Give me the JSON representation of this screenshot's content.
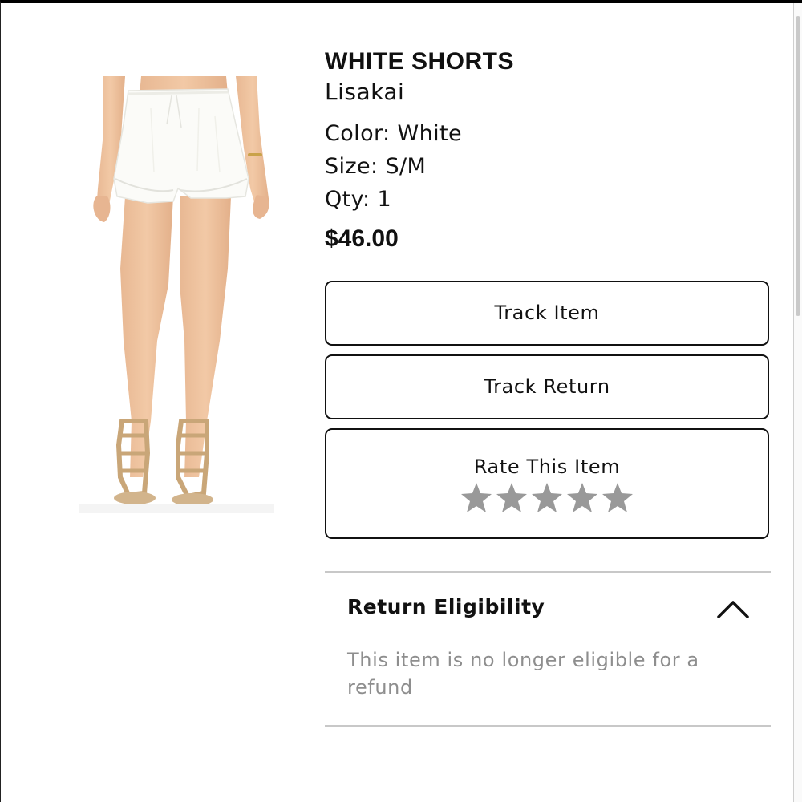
{
  "product": {
    "title": "WHITE SHORTS",
    "brand": "Lisakai",
    "color_line": "Color: White",
    "size_line": "Size: S/M",
    "qty_line": "Qty: 1",
    "price": "$46.00",
    "image_icon": "product-photo-white-shorts"
  },
  "actions": {
    "track_item": "Track Item",
    "track_return": "Track Return",
    "rate_label": "Rate This Item",
    "rating": {
      "value": 0,
      "max": 5
    },
    "star_color": "#999999"
  },
  "return_section": {
    "title": "Return Eligibility",
    "message": "This item is no longer eligible for a refund",
    "expanded": true,
    "toggle_icon": "chevron-up-icon"
  }
}
